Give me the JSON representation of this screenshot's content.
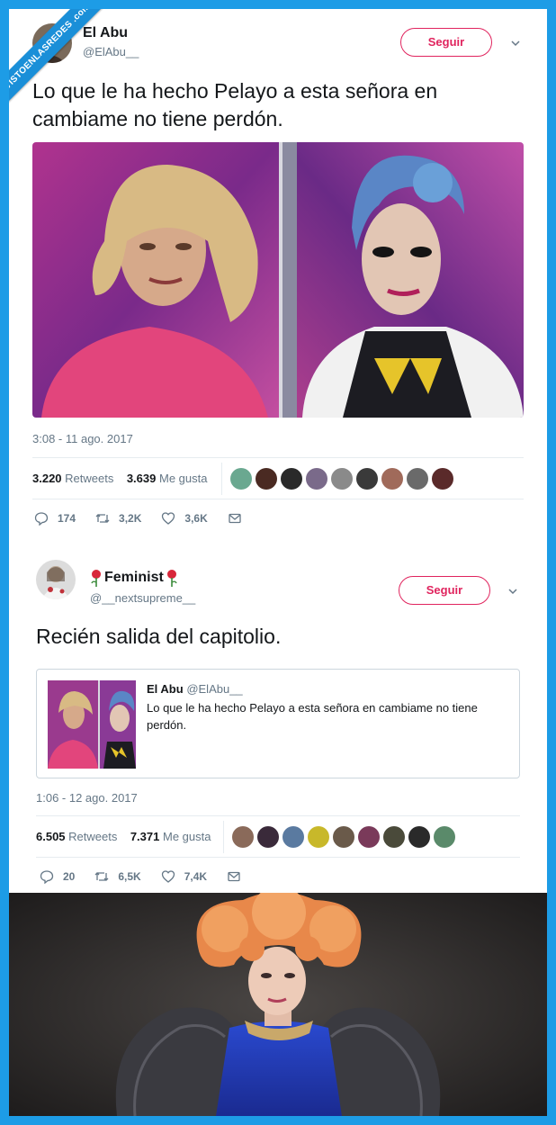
{
  "watermark": "VISTOENLASREDES .com",
  "tweet1": {
    "name": "El Abu",
    "handle": "@ElAbu__",
    "follow_label": "Seguir",
    "text": "Lo que le ha hecho Pelayo a esta señora en cambiame no tiene perdón.",
    "timestamp": "3:08 - 11 ago. 2017",
    "retweets_count": "3.220",
    "retweets_label": "Retweets",
    "likes_count": "3.639",
    "likes_label": "Me gusta",
    "replies": "174",
    "retweets_short": "3,2K",
    "likes_short": "3,6K"
  },
  "tweet2": {
    "name": "Feminist",
    "handle": "@__nextsupreme__",
    "follow_label": "Seguir",
    "text": "Recién salida del capitolio.",
    "quoted": {
      "name": "El Abu",
      "handle": "@ElAbu__",
      "text": "Lo que le ha hecho Pelayo a esta señora en cambiame no tiene perdón."
    },
    "timestamp": "1:06 - 12 ago. 2017",
    "retweets_count": "6.505",
    "retweets_label": "Retweets",
    "likes_count": "7.371",
    "likes_label": "Me gusta",
    "replies": "20",
    "retweets_short": "6,5K",
    "likes_short": "7,4K"
  },
  "colors": {
    "frame": "#1d9ce6",
    "follow": "#e0245e",
    "muted": "#657786"
  },
  "icons": [
    "reply-icon",
    "retweet-icon",
    "like-icon",
    "message-icon",
    "chevron-down-icon",
    "rose-icon"
  ]
}
